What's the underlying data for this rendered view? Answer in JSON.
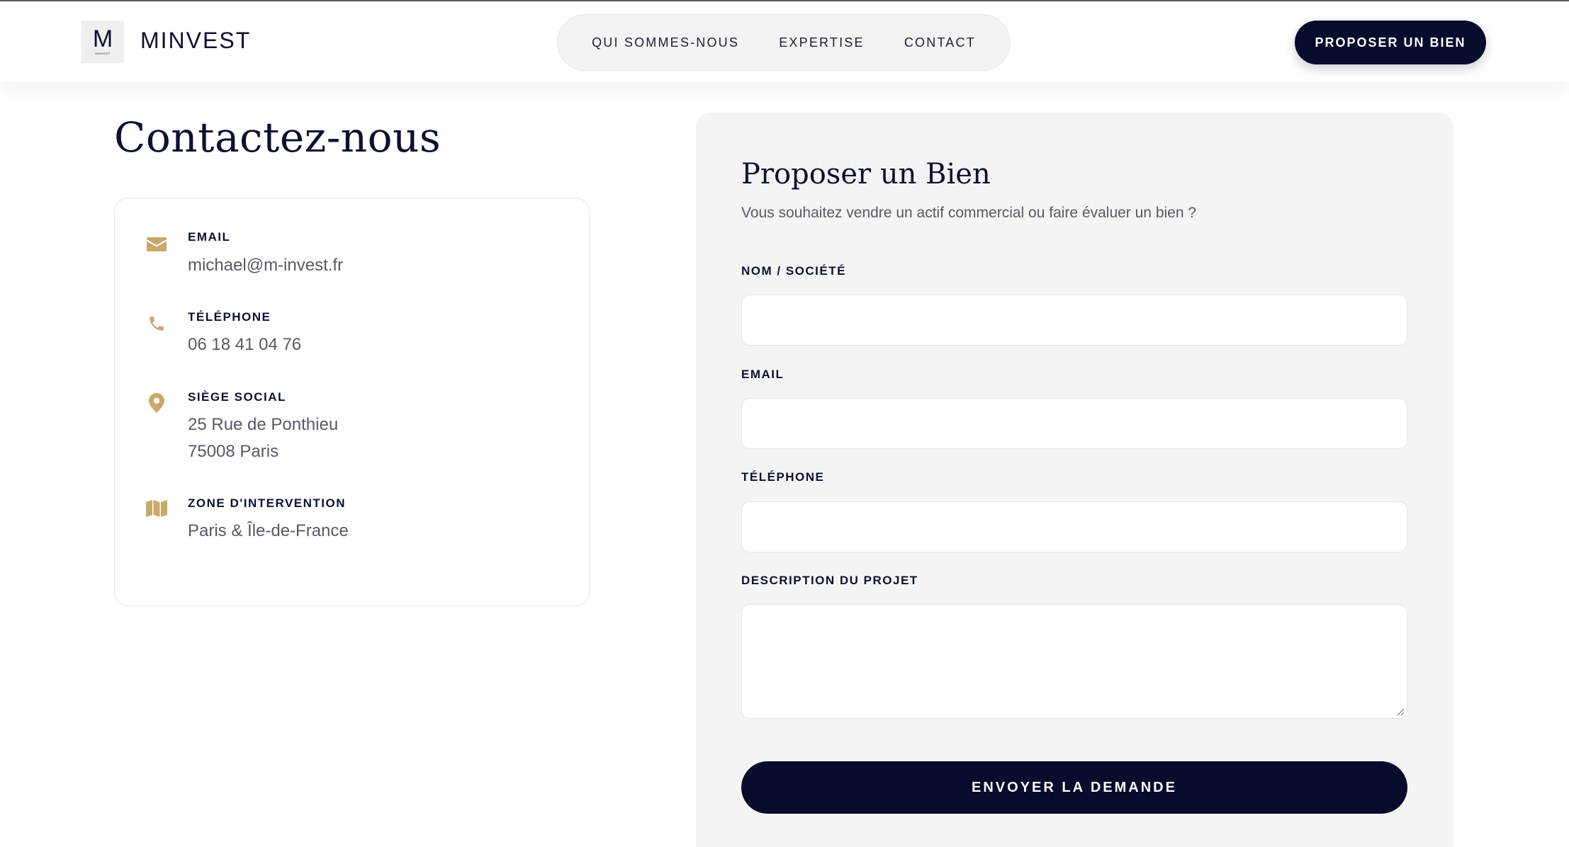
{
  "header": {
    "logo_letter": "M",
    "logo_small_text": "MINVEST",
    "brand": "MINVEST",
    "nav": [
      {
        "label": "QUI SOMMES-NOUS"
      },
      {
        "label": "EXPERTISE"
      },
      {
        "label": "CONTACT"
      }
    ],
    "cta_label": "PROPOSER UN BIEN"
  },
  "contact": {
    "title": "Contactez-nous",
    "items": [
      {
        "icon": "envelope-icon",
        "label": "EMAIL",
        "lines": [
          "michael@m-invest.fr"
        ]
      },
      {
        "icon": "phone-icon",
        "label": "TÉLÉPHONE",
        "lines": [
          "06 18 41 04 76"
        ]
      },
      {
        "icon": "map-pin-icon",
        "label": "SIÈGE SOCIAL",
        "lines": [
          "25 Rue de Ponthieu",
          "75008 Paris"
        ]
      },
      {
        "icon": "map-icon",
        "label": "ZONE D'INTERVENTION",
        "lines": [
          "Paris & Île-de-France"
        ]
      }
    ]
  },
  "form": {
    "title": "Proposer un Bien",
    "subtitle": "Vous souhaitez vendre un actif commercial ou faire évaluer un bien ?",
    "fields": {
      "name": {
        "label": "NOM / SOCIÉTÉ",
        "value": "",
        "placeholder": ""
      },
      "email": {
        "label": "EMAIL",
        "value": "",
        "placeholder": ""
      },
      "phone": {
        "label": "TÉLÉPHONE",
        "value": "",
        "placeholder": ""
      },
      "description": {
        "label": "DESCRIPTION DU PROJET",
        "value": "",
        "placeholder": ""
      }
    },
    "submit_label": "ENVOYER LA DEMANDE"
  },
  "colors": {
    "navy": "#070b2c",
    "gold": "#c9a869",
    "panel": "#f4f4f4",
    "text_muted": "#555a66"
  }
}
